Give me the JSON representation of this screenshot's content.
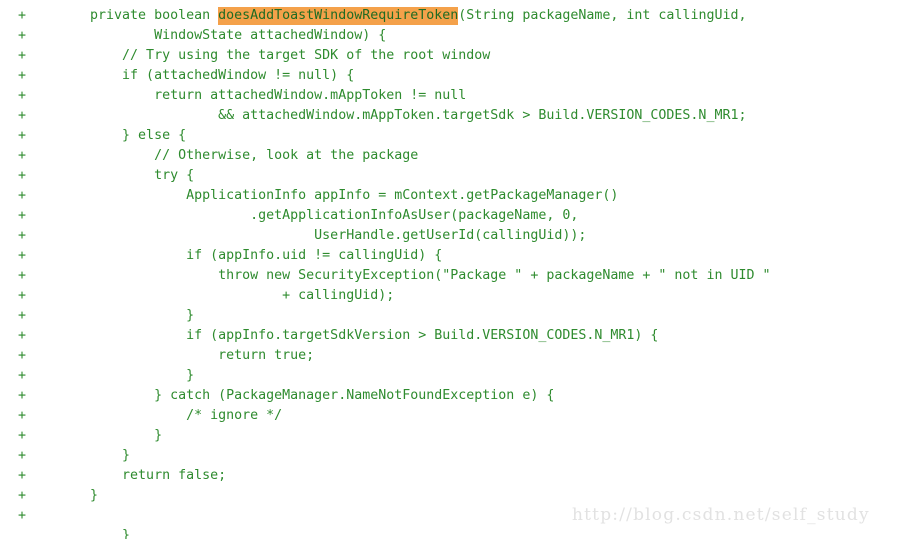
{
  "editor": {
    "background_color": "#ffffff",
    "added_line_color": "#2e8b2e",
    "highlight_background_color": "#f4a14a",
    "highlight_text_color": "#1f6b22",
    "marker": "+",
    "language": "java",
    "lines": [
      {
        "marker": "+",
        "indent": "    ",
        "pre": "private boolean ",
        "highlight": "doesAddToastWindowRequireToken",
        "post": "(String packageName, int callingUid,"
      },
      {
        "marker": "+",
        "text": "            WindowState attachedWindow) {"
      },
      {
        "marker": "+",
        "text": "        // Try using the target SDK of the root window"
      },
      {
        "marker": "+",
        "text": "        if (attachedWindow != null) {"
      },
      {
        "marker": "+",
        "text": "            return attachedWindow.mAppToken != null"
      },
      {
        "marker": "+",
        "text": "                    && attachedWindow.mAppToken.targetSdk > Build.VERSION_CODES.N_MR1;"
      },
      {
        "marker": "+",
        "text": "        } else {"
      },
      {
        "marker": "+",
        "text": "            // Otherwise, look at the package"
      },
      {
        "marker": "+",
        "text": "            try {"
      },
      {
        "marker": "+",
        "text": "                ApplicationInfo appInfo = mContext.getPackageManager()"
      },
      {
        "marker": "+",
        "text": "                        .getApplicationInfoAsUser(packageName, 0,"
      },
      {
        "marker": "+",
        "text": "                                UserHandle.getUserId(callingUid));"
      },
      {
        "marker": "+",
        "text": "                if (appInfo.uid != callingUid) {"
      },
      {
        "marker": "+",
        "text": "                    throw new SecurityException(\"Package \" + packageName + \" not in UID \""
      },
      {
        "marker": "+",
        "text": "                            + callingUid);"
      },
      {
        "marker": "+",
        "text": "                }"
      },
      {
        "marker": "+",
        "text": "                if (appInfo.targetSdkVersion > Build.VERSION_CODES.N_MR1) {"
      },
      {
        "marker": "+",
        "text": "                    return true;"
      },
      {
        "marker": "+",
        "text": "                }"
      },
      {
        "marker": "+",
        "text": "            } catch (PackageManager.NameNotFoundException e) {"
      },
      {
        "marker": "+",
        "text": "                /* ignore */"
      },
      {
        "marker": "+",
        "text": "            }"
      },
      {
        "marker": "+",
        "text": "        }"
      },
      {
        "marker": "+",
        "text": "        return false;"
      },
      {
        "marker": "+",
        "text": "    }"
      },
      {
        "marker": "+",
        "text": ""
      },
      {
        "marker": "",
        "text": "        }"
      }
    ]
  },
  "watermark": {
    "text": "http://blog.csdn.net/self_study",
    "color": "#e2e2e2"
  }
}
